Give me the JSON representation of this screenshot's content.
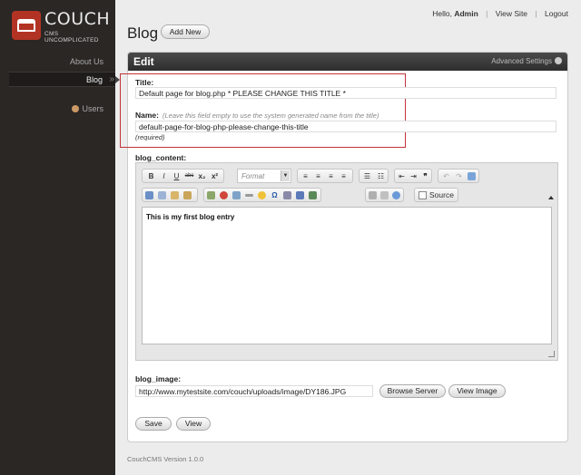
{
  "brand": {
    "name": "COUCH",
    "tagline": "CMS UNCOMPLICATED",
    "accent": "#b23323"
  },
  "sidebar": {
    "items": [
      {
        "label": "About Us"
      },
      {
        "label": "Blog",
        "marker": "»"
      },
      {
        "label": "Users",
        "icon": "users-icon"
      }
    ]
  },
  "topbar": {
    "hello": "Hello,",
    "user": "Admin",
    "view_site": "View Site",
    "logout": "Logout"
  },
  "page": {
    "title": "Blog",
    "add_new": "Add New"
  },
  "panel": {
    "title": "Edit",
    "advanced": "Advanced Settings"
  },
  "form": {
    "title_label": "Title:",
    "title_value": "Default page for blog.php * PLEASE CHANGE THIS TITLE *",
    "name_label": "Name:",
    "name_hint": "(Leave this field empty to use the system generated name from the title)",
    "name_value": "default-page-for-blog-php-please-change-this-title",
    "name_required": "(required)",
    "content_label": "blog_content:",
    "content_text": "This is my first blog entry",
    "image_label": "blog_image:",
    "image_value": "http://www.mytestsite.com/couch/uploads/image/DY186.JPG",
    "browse_server": "Browse Server",
    "view_image": "View Image",
    "save": "Save",
    "view": "View"
  },
  "editor": {
    "format_placeholder": "Format",
    "source_label": "Source"
  },
  "footer": "CouchCMS Version 1.0.0"
}
